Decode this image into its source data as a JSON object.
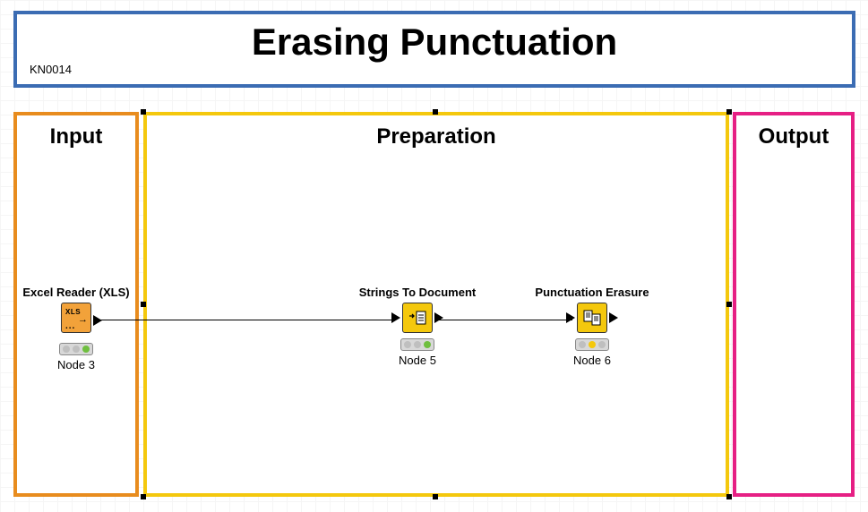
{
  "title": {
    "main": "Erasing Punctuation",
    "code": "KN0014"
  },
  "sections": {
    "input": {
      "label": "Input"
    },
    "preparation": {
      "label": "Preparation"
    },
    "output": {
      "label": "Output"
    }
  },
  "nodes": {
    "excel_reader": {
      "title": "Excel Reader (XLS)",
      "label": "Node 3",
      "icon_text": "XLS",
      "status": "green"
    },
    "strings_to_doc": {
      "title": "Strings To Document",
      "label": "Node 5",
      "status": "green"
    },
    "punct_erasure": {
      "title": "Punctuation Erasure",
      "label": "Node 6",
      "status": "yellow"
    }
  }
}
